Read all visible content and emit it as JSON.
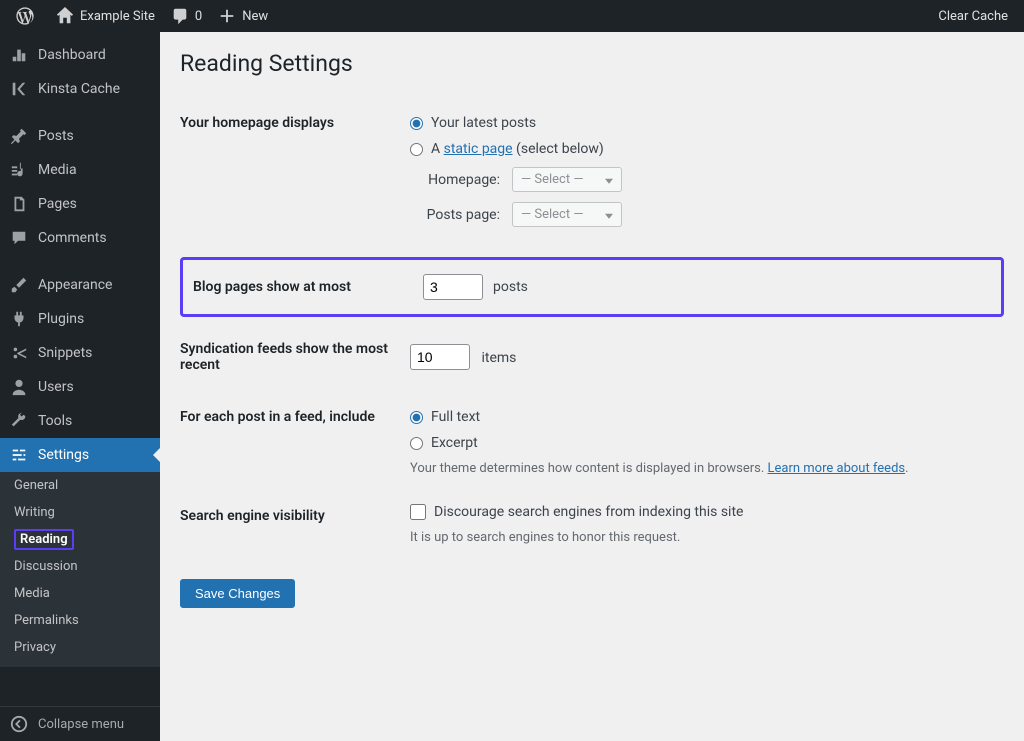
{
  "adminbar": {
    "site_name": "Example Site",
    "comments_count": "0",
    "new_label": "New",
    "clear_cache": "Clear Cache"
  },
  "sidebar": {
    "items": [
      {
        "label": "Dashboard"
      },
      {
        "label": "Kinsta Cache"
      },
      {
        "label": "Posts"
      },
      {
        "label": "Media"
      },
      {
        "label": "Pages"
      },
      {
        "label": "Comments"
      },
      {
        "label": "Appearance"
      },
      {
        "label": "Plugins"
      },
      {
        "label": "Snippets"
      },
      {
        "label": "Users"
      },
      {
        "label": "Tools"
      },
      {
        "label": "Settings"
      }
    ],
    "collapse": "Collapse menu"
  },
  "settings_submenu": [
    {
      "label": "General"
    },
    {
      "label": "Writing"
    },
    {
      "label": "Reading"
    },
    {
      "label": "Discussion"
    },
    {
      "label": "Media"
    },
    {
      "label": "Permalinks"
    },
    {
      "label": "Privacy"
    }
  ],
  "page": {
    "title": "Reading Settings",
    "homepage_label": "Your homepage displays",
    "homepage_opt1": "Your latest posts",
    "homepage_opt2_prefix": "A ",
    "homepage_opt2_link": "static page",
    "homepage_opt2_suffix": " (select below)",
    "homepage_select_label": "Homepage:",
    "posts_select_label": "Posts page:",
    "select_placeholder": "— Select —",
    "blog_pages_label": "Blog pages show at most",
    "blog_pages_value": "3",
    "blog_pages_suffix": "posts",
    "syndication_label": "Syndication feeds show the most recent",
    "syndication_value": "10",
    "syndication_suffix": "items",
    "feed_label": "For each post in a feed, include",
    "feed_opt1": "Full text",
    "feed_opt2": "Excerpt",
    "feed_desc_prefix": "Your theme determines how content is displayed in browsers. ",
    "feed_desc_link": "Learn more about feeds",
    "feed_desc_suffix": ".",
    "search_label": "Search engine visibility",
    "search_checkbox": "Discourage search engines from indexing this site",
    "search_desc": "It is up to search engines to honor this request.",
    "save_button": "Save Changes"
  }
}
